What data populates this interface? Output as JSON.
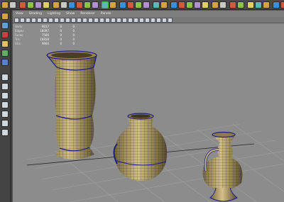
{
  "panel_menu": [
    "View",
    "Shading",
    "Lighting",
    "Show",
    "Renderer",
    "Panels"
  ],
  "hud": {
    "rows": [
      {
        "label": "Verts:",
        "v1": "9017",
        "v2": "0",
        "v3": "0"
      },
      {
        "label": "Edges:",
        "v1": "18097",
        "v2": "0",
        "v3": "0"
      },
      {
        "label": "Faces:",
        "v1": "7586",
        "v2": "0",
        "v3": "0"
      },
      {
        "label": "Tris:",
        "v1": "16828",
        "v2": "0",
        "v3": "0"
      },
      {
        "label": "UVs:",
        "v1": "9660",
        "v2": "0",
        "v3": "0"
      }
    ]
  },
  "colors": {
    "viewport_bg": "#8c8c8c",
    "wireframe": "#1c1d8c",
    "pottery_light": "#c7b27a",
    "pottery_dark": "#6b5a3a",
    "grid": "#9a9a9a",
    "highlight_tool": "#3cb43c"
  },
  "icons": {
    "shelf": [
      "layout-icon",
      "menu-icon",
      "sep",
      "snap-grid-icon",
      "snap-curve-icon",
      "snap-point-icon",
      "snap-plane-icon",
      "sep",
      "cube-icon",
      "sphere-icon",
      "cylinder-icon",
      "cone-icon",
      "plane-icon",
      "torus-icon",
      "sep",
      "select-icon",
      "lasso-icon",
      "sep",
      "render-icon",
      "ipr-icon",
      "render-settings-icon",
      "hypershade-icon",
      "sep",
      "camera-icon",
      "light-icon",
      "sep",
      "extrude-icon",
      "bevel-icon",
      "bridge-icon",
      "merge-icon",
      "split-icon",
      "sep",
      "paint-icon",
      "sculpt-icon",
      "sep",
      "uv-icon",
      "texture-icon",
      "sep",
      "attribute-editor-icon",
      "channel-box-icon",
      "tool-settings-icon",
      "sep",
      "rig-icon",
      "skin-icon"
    ],
    "tools": [
      "select-tool-icon",
      "lasso-tool-icon",
      "paint-select-icon",
      "move-tool-icon",
      "rotate-tool-icon",
      "scale-tool-icon",
      "sep",
      "four-view-icon",
      "single-view-icon",
      "two-view-icon",
      "outliner-icon",
      "graph-editor-icon",
      "hypergraph-icon",
      "render-view-icon"
    ]
  }
}
